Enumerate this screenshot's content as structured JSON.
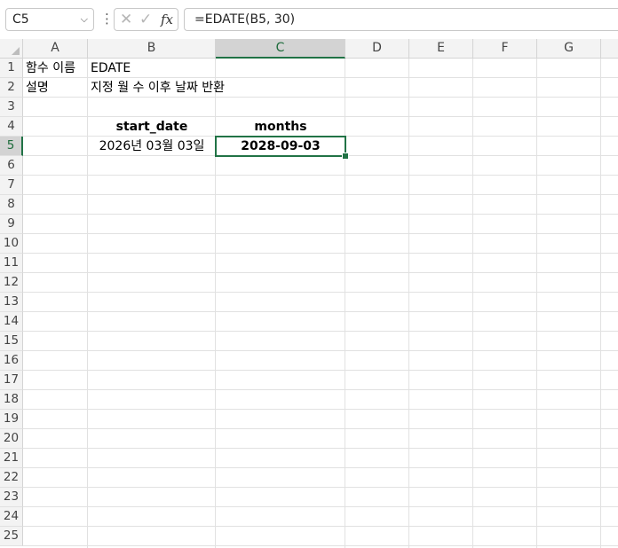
{
  "formula_bar": {
    "name_box": "C5",
    "formula": "=EDATE(B5, 30)",
    "cancel_glyph": "✕",
    "enter_glyph": "✓",
    "fx_label": "fx"
  },
  "columns": [
    "A",
    "B",
    "C",
    "D",
    "E",
    "F",
    "G"
  ],
  "rows": [
    "1",
    "2",
    "3",
    "4",
    "5",
    "6",
    "7",
    "8",
    "9",
    "10",
    "11",
    "12",
    "13",
    "14",
    "15",
    "16",
    "17",
    "18",
    "19",
    "20",
    "21",
    "22",
    "23",
    "24",
    "25"
  ],
  "cells": {
    "A1": "함수 이름",
    "B1": "EDATE",
    "A2": "설명",
    "B2": "지정 월 수 이후 날짜 반환",
    "B4": "start_date",
    "C4": "months",
    "B5": "2026년 03월 03일",
    "C5": "2028-09-03"
  },
  "selection": {
    "active_cell": "C5",
    "accent_color": "#217346"
  }
}
